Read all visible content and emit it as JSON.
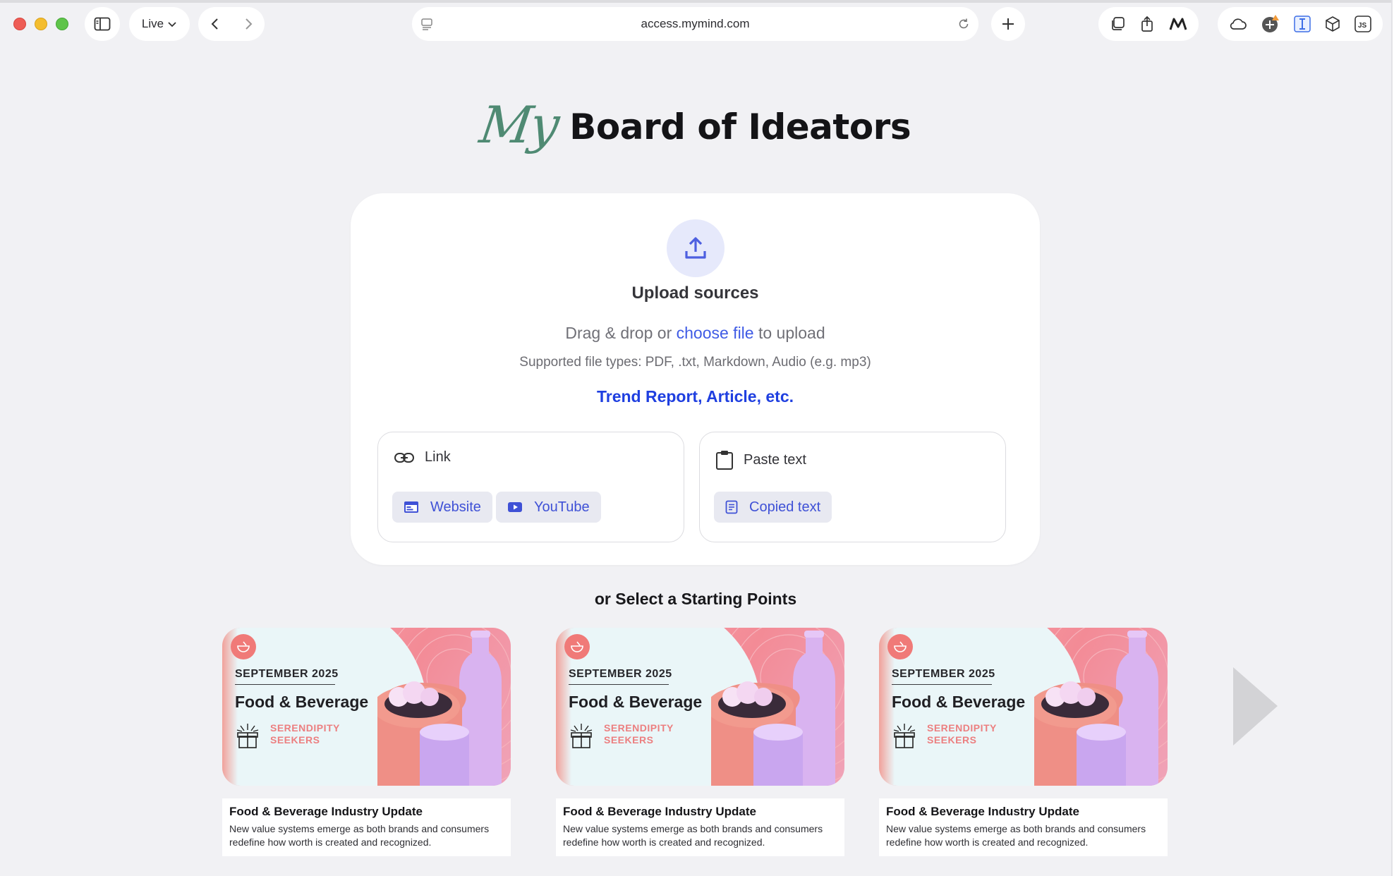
{
  "browser": {
    "tab_group_label": "Live",
    "url": "access.mymind.com"
  },
  "header": {
    "brand_prefix": "My",
    "title": "Board of Ideators"
  },
  "upload": {
    "title": "Upload sources",
    "drag_prefix": "Drag & drop or",
    "choose_file": "choose file",
    "drag_suffix": "to upload",
    "supported": "Supported file types: PDF, .txt, Markdown, Audio (e.g. mp3)",
    "examples": "Trend Report, Article, etc.",
    "link_option": {
      "label": "Link",
      "chips": [
        "Website",
        "YouTube"
      ]
    },
    "paste_option": {
      "label": "Paste text",
      "chips": [
        "Copied text"
      ]
    }
  },
  "starting_points": {
    "heading": "or Select a Starting Points",
    "cards": [
      {
        "date": "SEPTEMBER 2025",
        "category": "Food & Beverage",
        "brand_line1": "SERENDIPITY",
        "brand_line2": "SEEKERS",
        "title": "Food & Beverage Industry Update",
        "description": "New value systems emerge as both brands and consumers redefine how worth is created and recognized."
      },
      {
        "date": "SEPTEMBER 2025",
        "category": "Food & Beverage",
        "brand_line1": "SERENDIPITY",
        "brand_line2": "SEEKERS",
        "title": "Food & Beverage Industry Update",
        "description": "New value systems emerge as both brands and consumers redefine how worth is created and recognized."
      },
      {
        "date": "SEPTEMBER 2025",
        "category": "Food & Beverage",
        "brand_line1": "SERENDIPITY",
        "brand_line2": "SEEKERS",
        "title": "Food & Beverage Industry Update",
        "description": "New value systems emerge as both brands and consumers redefine how worth is created and recognized."
      }
    ]
  },
  "icons": {
    "upload": "upload-icon",
    "link": "link-icon",
    "clipboard": "clipboard-icon",
    "website": "browser-window-icon",
    "youtube": "video-play-icon",
    "copied_text": "document-icon",
    "next": "next-arrow-icon"
  },
  "colors": {
    "accent": "#3f5be5",
    "brand_green": "#4f8a73",
    "card_pink": "#f38b96"
  }
}
